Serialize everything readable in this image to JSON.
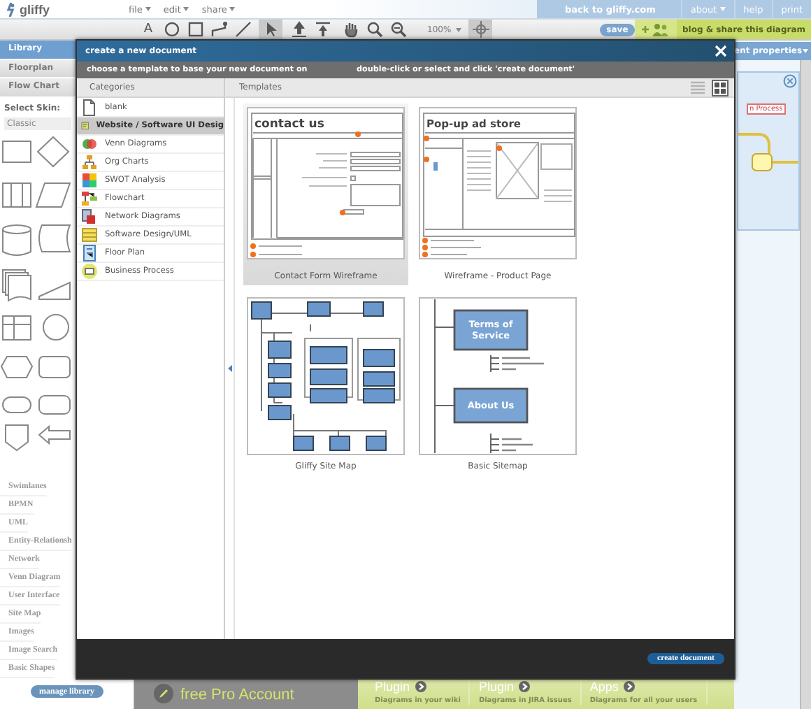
{
  "app": {
    "logo": "gliffy",
    "menus": [
      {
        "label": "file"
      },
      {
        "label": "edit"
      },
      {
        "label": "share"
      }
    ],
    "top_links": [
      {
        "label": "back to gliffy.com",
        "kind": "link"
      },
      {
        "label": "about",
        "kind": "menu"
      },
      {
        "label": "help",
        "kind": "link"
      },
      {
        "label": "print",
        "kind": "link"
      }
    ]
  },
  "toolbar": {
    "tools": [
      {
        "kind": "text",
        "label": "A",
        "selected": false
      },
      {
        "kind": "ellipse",
        "selected": false
      },
      {
        "kind": "rectangle",
        "selected": false
      },
      {
        "kind": "connector",
        "selected": false
      },
      {
        "kind": "line",
        "selected": false
      },
      {
        "kind": "pointer",
        "selected": true
      },
      {
        "kind": "bring-forward",
        "selected": false
      },
      {
        "kind": "bring-front",
        "selected": false
      },
      {
        "kind": "hand",
        "selected": false
      },
      {
        "kind": "zoom-in",
        "selected": false
      },
      {
        "kind": "zoom-out",
        "selected": false
      },
      {
        "kind": "zoom",
        "label": "100%",
        "selected": false
      },
      {
        "kind": "snap",
        "selected": true
      }
    ],
    "save_button": "save",
    "share_button": "blog & share this diagram"
  },
  "library": {
    "tabs": [
      {
        "label": "Library",
        "selected": true
      },
      {
        "label": "Floorplan",
        "selected": false
      },
      {
        "label": "Flow Chart",
        "selected": false
      }
    ],
    "skin_label": "Select Skin:",
    "skin": "Classic",
    "sections": [
      "Swimlanes",
      "BPMN",
      "UML",
      "Entity-Relationsh",
      "Network",
      "Venn Diagram",
      "User Interface",
      "Site Map",
      "Images",
      "Image Search",
      "Basic Shapes"
    ],
    "manage_button": "manage library"
  },
  "properties_panel": {
    "title": "ent properties",
    "preview_label": "n Process"
  },
  "dialog": {
    "title": "create a new document",
    "instruction": "choose a template to base your new document on",
    "hint": "double-click or select and click 'create document'",
    "categories_heading": "Categories",
    "templates_heading": "Templates",
    "views": [
      {
        "kind": "list",
        "selected": false
      },
      {
        "kind": "grid",
        "selected": true
      }
    ],
    "categories": [
      {
        "label": "blank",
        "selected": false
      },
      {
        "label": "Website / Software UI Desig",
        "selected": true
      },
      {
        "label": "Venn Diagrams",
        "selected": false
      },
      {
        "label": "Org Charts",
        "selected": false
      },
      {
        "label": "SWOT Analysis",
        "selected": false
      },
      {
        "label": "Flowchart",
        "selected": false
      },
      {
        "label": "Network Diagrams",
        "selected": false
      },
      {
        "label": "Software Design/UML",
        "selected": false
      },
      {
        "label": "Floor Plan",
        "selected": false
      },
      {
        "label": "Business Process",
        "selected": false
      }
    ],
    "templates": [
      {
        "name": "Contact Form Wireframe",
        "kind": "contact-form",
        "headline": "contact us",
        "selected": true
      },
      {
        "name": "Wireframe - Product Page",
        "kind": "product-page",
        "headline": "Pop-up ad store",
        "selected": false
      },
      {
        "name": "Gliffy Site Map",
        "kind": "site-map",
        "selected": false
      },
      {
        "name": "Basic Sitemap",
        "kind": "basic-sitemap",
        "nodes": [
          "Terms of Service",
          "About Us"
        ],
        "selected": false
      }
    ],
    "create_button": "create document"
  },
  "promo": {
    "title": "free Pro Account",
    "items": [
      {
        "title": "Plugin",
        "caption": "Diagrams in your wiki"
      },
      {
        "title": "Plugin",
        "caption": "Diagrams in JIRA issues"
      },
      {
        "title": "Apps",
        "caption": "Diagrams for all your users"
      }
    ]
  }
}
